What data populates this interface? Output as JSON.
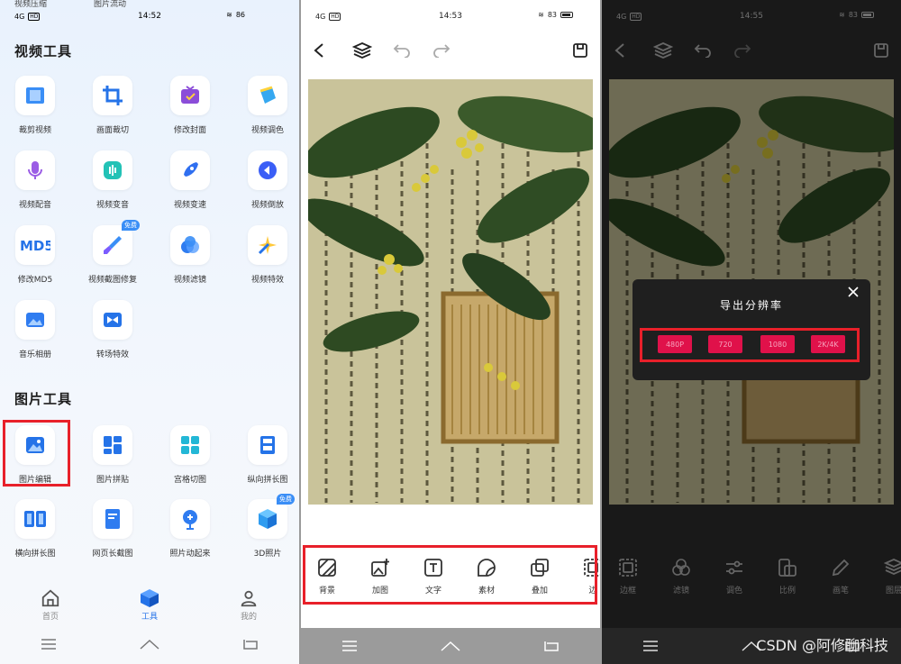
{
  "panel1": {
    "status": {
      "net": "4G",
      "time": "14:52",
      "battery": "86"
    },
    "notes": [
      "视频压缩",
      "图片流动"
    ],
    "video_section": "视频工具",
    "video_tools": [
      {
        "label": "裁剪视频",
        "icon": "crop-video-icon"
      },
      {
        "label": "画面裁切",
        "icon": "frame-crop-icon"
      },
      {
        "label": "修改封面",
        "icon": "cover-icon"
      },
      {
        "label": "视频调色",
        "icon": "color-bucket-icon"
      },
      {
        "label": "视频配音",
        "icon": "microphone-icon"
      },
      {
        "label": "视频变音",
        "icon": "voice-change-icon"
      },
      {
        "label": "视频变速",
        "icon": "rocket-icon"
      },
      {
        "label": "视频倒放",
        "icon": "rewind-icon"
      },
      {
        "label": "修改MD5",
        "icon": "md5-icon"
      },
      {
        "label": "视频截图修复",
        "icon": "brush-icon",
        "badge": "免费"
      },
      {
        "label": "视频滤镜",
        "icon": "filter-icon"
      },
      {
        "label": "视频特效",
        "icon": "sparkle-icon"
      },
      {
        "label": "音乐相册",
        "icon": "photo-album-icon"
      },
      {
        "label": "转场特效",
        "icon": "transition-icon"
      }
    ],
    "image_section": "图片工具",
    "image_tools": [
      {
        "label": "图片编辑",
        "icon": "image-edit-icon"
      },
      {
        "label": "图片拼贴",
        "icon": "collage-icon"
      },
      {
        "label": "宫格切图",
        "icon": "grid-cut-icon"
      },
      {
        "label": "纵向拼长图",
        "icon": "vertical-stitch-icon"
      },
      {
        "label": "横向拼长图",
        "icon": "horizontal-stitch-icon"
      },
      {
        "label": "网页长截图",
        "icon": "webpage-screenshot-icon"
      },
      {
        "label": "照片动起来",
        "icon": "animate-photo-icon"
      },
      {
        "label": "3D照片",
        "icon": "cube-icon",
        "badge": "免费"
      }
    ],
    "tabs": [
      {
        "label": "首页",
        "icon": "home-icon"
      },
      {
        "label": "工具",
        "icon": "box-icon"
      },
      {
        "label": "我的",
        "icon": "user-icon"
      }
    ]
  },
  "panel2": {
    "status": {
      "net": "4G",
      "time": "14:53",
      "battery": "83"
    },
    "tools": [
      {
        "label": "背景",
        "icon": "background-icon"
      },
      {
        "label": "加图",
        "icon": "add-image-icon"
      },
      {
        "label": "文字",
        "icon": "text-icon"
      },
      {
        "label": "素材",
        "icon": "sticker-icon"
      },
      {
        "label": "叠加",
        "icon": "overlay-icon"
      },
      {
        "label": "边",
        "icon": "border-icon"
      }
    ]
  },
  "panel3": {
    "status": {
      "net": "4G",
      "time": "14:55",
      "battery": "83"
    },
    "dialog_title": "导出分辨率",
    "resolutions": [
      "480P",
      "720",
      "1080",
      "2K/4K"
    ],
    "tools": [
      {
        "label": "边框",
        "icon": "frame-icon"
      },
      {
        "label": "滤镜",
        "icon": "filter-circles-icon"
      },
      {
        "label": "调色",
        "icon": "adjust-icon"
      },
      {
        "label": "比例",
        "icon": "ratio-icon"
      },
      {
        "label": "画笔",
        "icon": "pen-icon"
      },
      {
        "label": "图层",
        "icon": "layers-icon"
      }
    ],
    "watermark": "CSDN @阿修聊科技"
  },
  "colors": {
    "accent": "#2573e8",
    "highlight_box": "#e8202a",
    "resolution_btn": "#e0114a"
  }
}
